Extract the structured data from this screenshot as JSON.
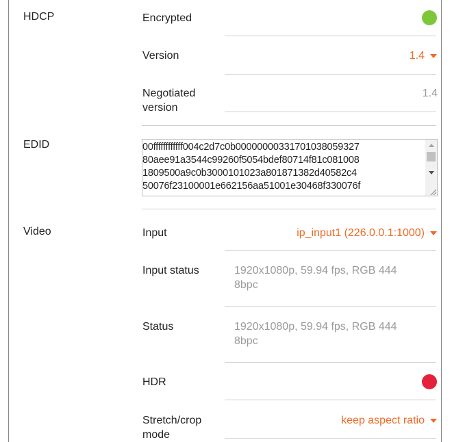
{
  "hdcp": {
    "section_label": "HDCP",
    "encrypted_label": "Encrypted",
    "encrypted_status_color": "#7ec73a",
    "version_label": "Version",
    "version_value": "1.4",
    "negotiated_label_line1": "Negotiated",
    "negotiated_label_line2": "version",
    "negotiated_value": "1.4"
  },
  "edid": {
    "section_label": "EDID",
    "lines": [
      "00ffffffffffff004c2d7c0b000000003317010380593​27",
      "80aee91a3544c99260f5054bdef80714f81c081008",
      "1809500a9c0b3000101023a801871382d40582c4",
      "50076f23100001e662156aa51001e30468f330076f"
    ]
  },
  "video": {
    "section_label": "Video",
    "input_label": "Input",
    "input_value": "ip_input1 (226.0.0.1:1000)",
    "input_status_label": "Input status",
    "input_status_line1": "1920x1080p, 59.94 fps, RGB 444",
    "input_status_line2": "8bpc",
    "status_label": "Status",
    "status_line1": "1920x1080p, 59.94 fps, RGB 444",
    "status_line2": "8bpc",
    "hdr_label": "HDR",
    "hdr_status_color": "#e5203a",
    "stretch_label_line1": "Stretch/crop",
    "stretch_label_line2": "mode",
    "stretch_value": "keep aspect ratio"
  },
  "colors": {
    "accent_orange": "#ee6a25",
    "muted_gray": "#9a9a9a"
  }
}
